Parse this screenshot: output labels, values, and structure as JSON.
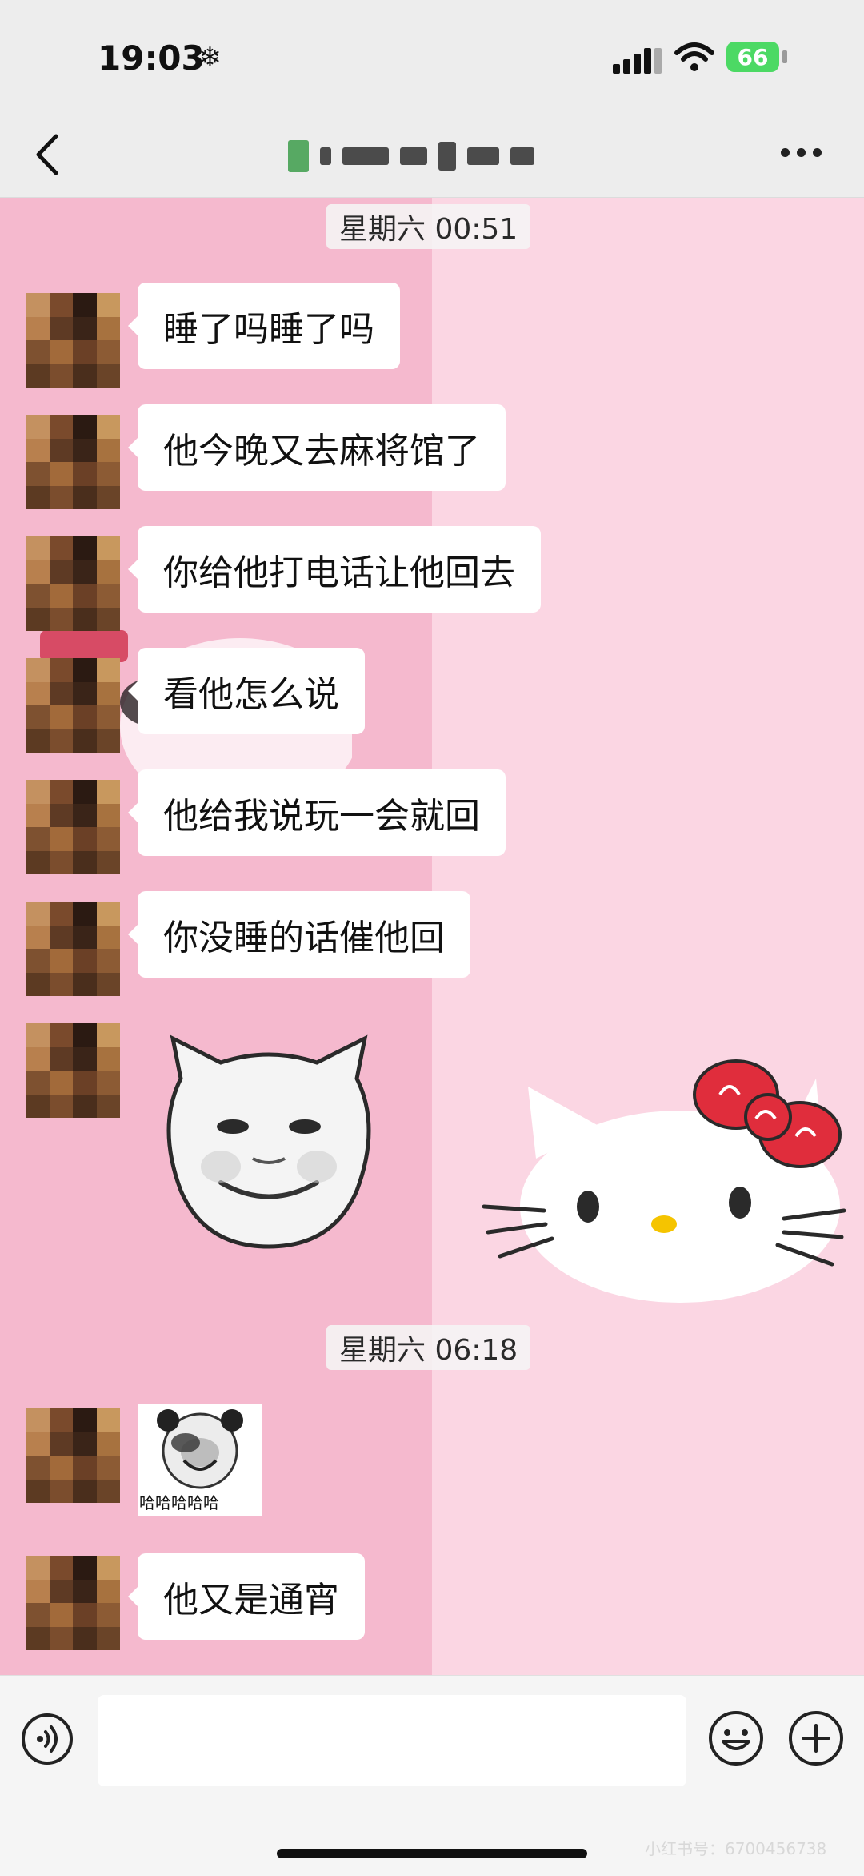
{
  "status_bar": {
    "time": "19:03",
    "weather_icon": "snowflake-icon",
    "battery_level": "66"
  },
  "nav": {
    "back_icon": "chevron-left-icon",
    "more_icon": "more-dots-icon"
  },
  "chat": {
    "timestamps": [
      "星期六 00:51",
      "星期六 06:18"
    ],
    "messages": [
      "睡了吗睡了吗",
      "他今晚又去麻将馆了",
      "你给他打电话让他回去",
      "看他怎么说",
      "他给我说玩一会就回",
      "你没睡的话催他回",
      "他又是通宵"
    ],
    "small_sticker_caption": "哈哈哈哈哈"
  },
  "input_bar": {
    "voice_icon": "voice-icon",
    "input_value": "",
    "emoji_icon": "emoji-icon",
    "plus_icon": "plus-icon",
    "watermark": "小红书号：6700456738"
  },
  "colors": {
    "chat_left_bg": "#f5b9ce",
    "chat_right_bg": "#fbd6e3",
    "bubble_bg": "#ffffff",
    "battery_green": "#4cd964",
    "kitty_bow": "#e02d3c"
  }
}
